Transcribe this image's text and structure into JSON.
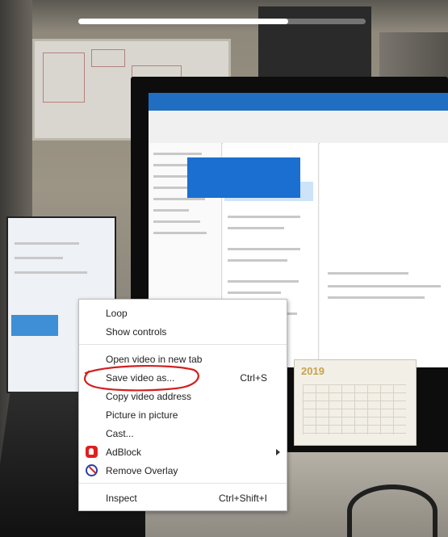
{
  "video": {
    "progress_fraction": 0.73,
    "calendar_year": "2019"
  },
  "context_menu": {
    "items": [
      {
        "label": "Loop",
        "shortcut": ""
      },
      {
        "label": "Show controls",
        "shortcut": ""
      },
      {
        "label": "Open video in new tab",
        "shortcut": ""
      },
      {
        "label": "Save video as...",
        "shortcut": "Ctrl+S"
      },
      {
        "label": "Copy video address",
        "shortcut": ""
      },
      {
        "label": "Picture in picture",
        "shortcut": ""
      },
      {
        "label": "Cast...",
        "shortcut": ""
      },
      {
        "label": "AdBlock",
        "shortcut": "",
        "icon": "adblock-icon",
        "has_submenu": true
      },
      {
        "label": "Remove Overlay",
        "shortcut": "",
        "icon": "remove-overlay-icon"
      },
      {
        "label": "Inspect",
        "shortcut": "Ctrl+Shift+I"
      }
    ]
  },
  "annotation": {
    "color": "#d41f1f",
    "target": "Save video as..."
  },
  "colors": {
    "menu_background": "#ffffff",
    "adblock_red": "#e01f1f",
    "remove_overlay_blue": "#2b3ea8"
  }
}
